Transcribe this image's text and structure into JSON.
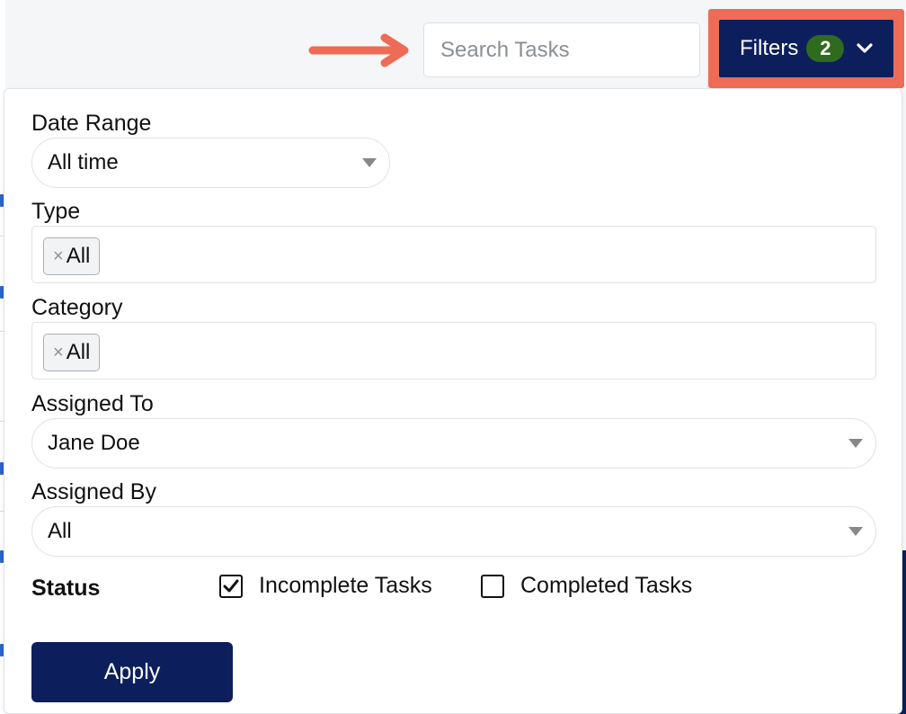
{
  "colors": {
    "primary": "#0c1f5c",
    "highlight": "#ee6b55",
    "badge": "#2f6b1e",
    "link": "#2b64c8"
  },
  "header": {
    "search_placeholder": "Search Tasks",
    "filters_label": "Filters",
    "filters_count": "2",
    "filters_icon": "chevron-down-icon"
  },
  "filters": {
    "date_range": {
      "label": "Date Range",
      "value": "All time"
    },
    "type": {
      "label": "Type",
      "tags": [
        "All"
      ]
    },
    "category": {
      "label": "Category",
      "tags": [
        "All"
      ]
    },
    "assigned_to": {
      "label": "Assigned To",
      "value": "Jane Doe"
    },
    "assigned_by": {
      "label": "Assigned By",
      "value": "All"
    },
    "status": {
      "label": "Status",
      "options": [
        {
          "label": "Incomplete Tasks",
          "checked": true
        },
        {
          "label": "Completed Tasks",
          "checked": false
        }
      ]
    },
    "apply_label": "Apply"
  }
}
